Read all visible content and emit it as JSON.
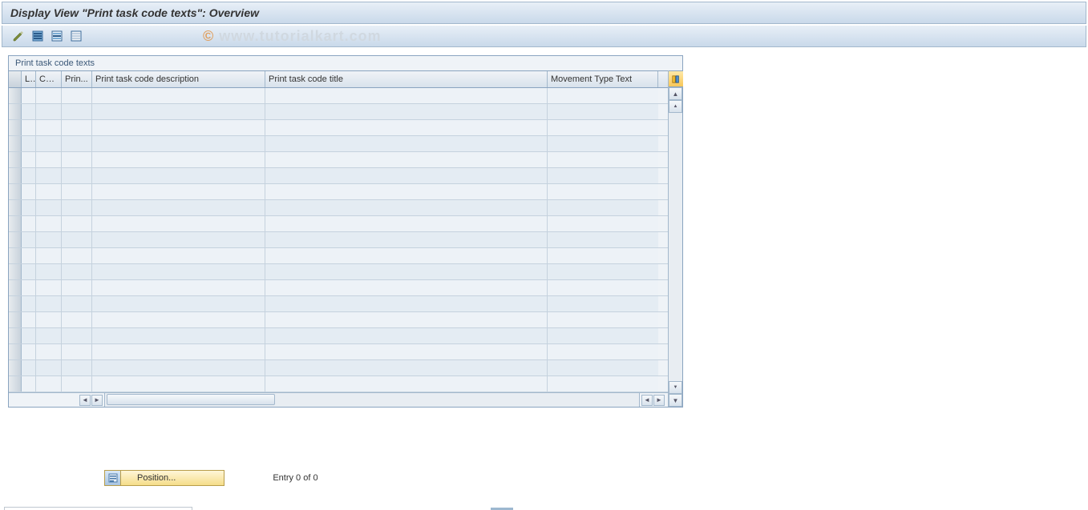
{
  "title": "Display View \"Print task code texts\": Overview",
  "watermark": "www.tutorialkart.com",
  "toolbar": {
    "icons": [
      {
        "name": "toggle-edit-icon"
      },
      {
        "name": "select-all-icon"
      },
      {
        "name": "select-block-icon"
      },
      {
        "name": "deselect-all-icon"
      }
    ]
  },
  "grid": {
    "panel_title": "Print task code texts",
    "columns": [
      {
        "key": "L",
        "label": "L..",
        "class": "col-L"
      },
      {
        "key": "CoCd",
        "label": "CoCd",
        "class": "col-CoCd"
      },
      {
        "key": "Prin",
        "label": "Prin...",
        "class": "col-Prin"
      },
      {
        "key": "desc",
        "label": "Print task code description",
        "class": "col-desc"
      },
      {
        "key": "title",
        "label": "Print task code title",
        "class": "col-title"
      },
      {
        "key": "movement",
        "label": "Movement Type Text",
        "class": "col-movement"
      }
    ],
    "row_count": 19,
    "rows": []
  },
  "footer": {
    "position_button": "Position...",
    "entry_text": "Entry 0 of 0"
  }
}
